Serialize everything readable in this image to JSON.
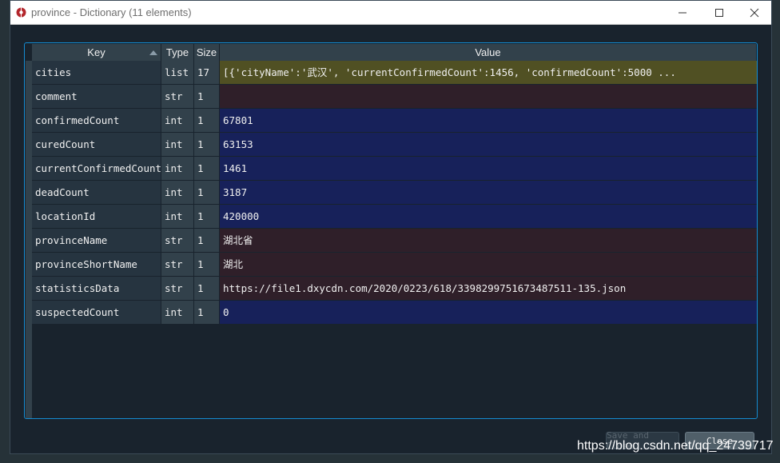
{
  "window": {
    "title": "province - Dictionary (11 elements)"
  },
  "table": {
    "headers": {
      "key": "Key",
      "type": "Type",
      "size": "Size",
      "value": "Value"
    },
    "rows": [
      {
        "key": "cities",
        "type": "list",
        "size": "17",
        "value": "[{'cityName':'武汉', 'currentConfirmedCount':1456, 'confirmedCount':5000 ...",
        "color": "#505023"
      },
      {
        "key": "comment",
        "type": "str",
        "size": "1",
        "value": "",
        "color": "#2f1f29"
      },
      {
        "key": "confirmedCount",
        "type": "int",
        "size": "1",
        "value": "67801",
        "color": "#17215a"
      },
      {
        "key": "curedCount",
        "type": "int",
        "size": "1",
        "value": "63153",
        "color": "#17215a"
      },
      {
        "key": "currentConfirmedCount",
        "type": "int",
        "size": "1",
        "value": "1461",
        "color": "#17215a"
      },
      {
        "key": "deadCount",
        "type": "int",
        "size": "1",
        "value": "3187",
        "color": "#17215a"
      },
      {
        "key": "locationId",
        "type": "int",
        "size": "1",
        "value": "420000",
        "color": "#17215a"
      },
      {
        "key": "provinceName",
        "type": "str",
        "size": "1",
        "value": "湖北省",
        "color": "#2f1f29"
      },
      {
        "key": "provinceShortName",
        "type": "str",
        "size": "1",
        "value": "湖北",
        "color": "#2f1f29"
      },
      {
        "key": "statisticsData",
        "type": "str",
        "size": "1",
        "value": "https://file1.dxycdn.com/2020/0223/618/3398299751673487511-135.json",
        "color": "#2f1f29"
      },
      {
        "key": "suspectedCount",
        "type": "int",
        "size": "1",
        "value": "0",
        "color": "#17215a"
      }
    ]
  },
  "footer": {
    "save_label": "Save and Close",
    "close_label": "Close"
  },
  "watermark": "https://blog.csdn.net/qq_24739717"
}
